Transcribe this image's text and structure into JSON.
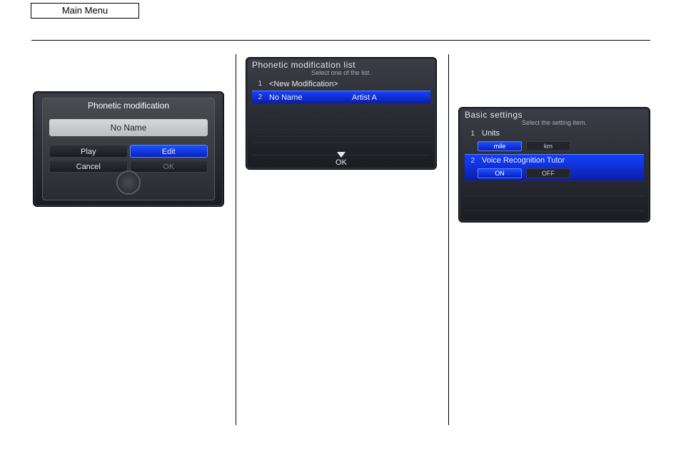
{
  "main_menu_label": "Main Menu",
  "screen1": {
    "popup_title": "Phonetic modification",
    "field_value": "No Name",
    "buttons": {
      "play": "Play",
      "edit": "Edit",
      "cancel": "Cancel",
      "ok": "OK"
    },
    "selected_button": "edit"
  },
  "screen2": {
    "title": "Phonetic modification list",
    "subtitle": "Select one of the list.",
    "rows": [
      {
        "num": "1",
        "left": "<New Modification>",
        "right": ""
      },
      {
        "num": "2",
        "left": "No Name",
        "right": "Artist A"
      }
    ],
    "selected_index": 1,
    "ok_label": "OK"
  },
  "screen3": {
    "title": "Basic settings",
    "subtitle": "Select the setting item.",
    "items": [
      {
        "num": "1",
        "label": "Units",
        "options": [
          "mile",
          "km"
        ],
        "selected": 0
      },
      {
        "num": "2",
        "label": "Voice Recognition Tutor",
        "options": [
          "ON",
          "OFF"
        ],
        "selected": 0
      }
    ],
    "highlight_index": 1
  }
}
